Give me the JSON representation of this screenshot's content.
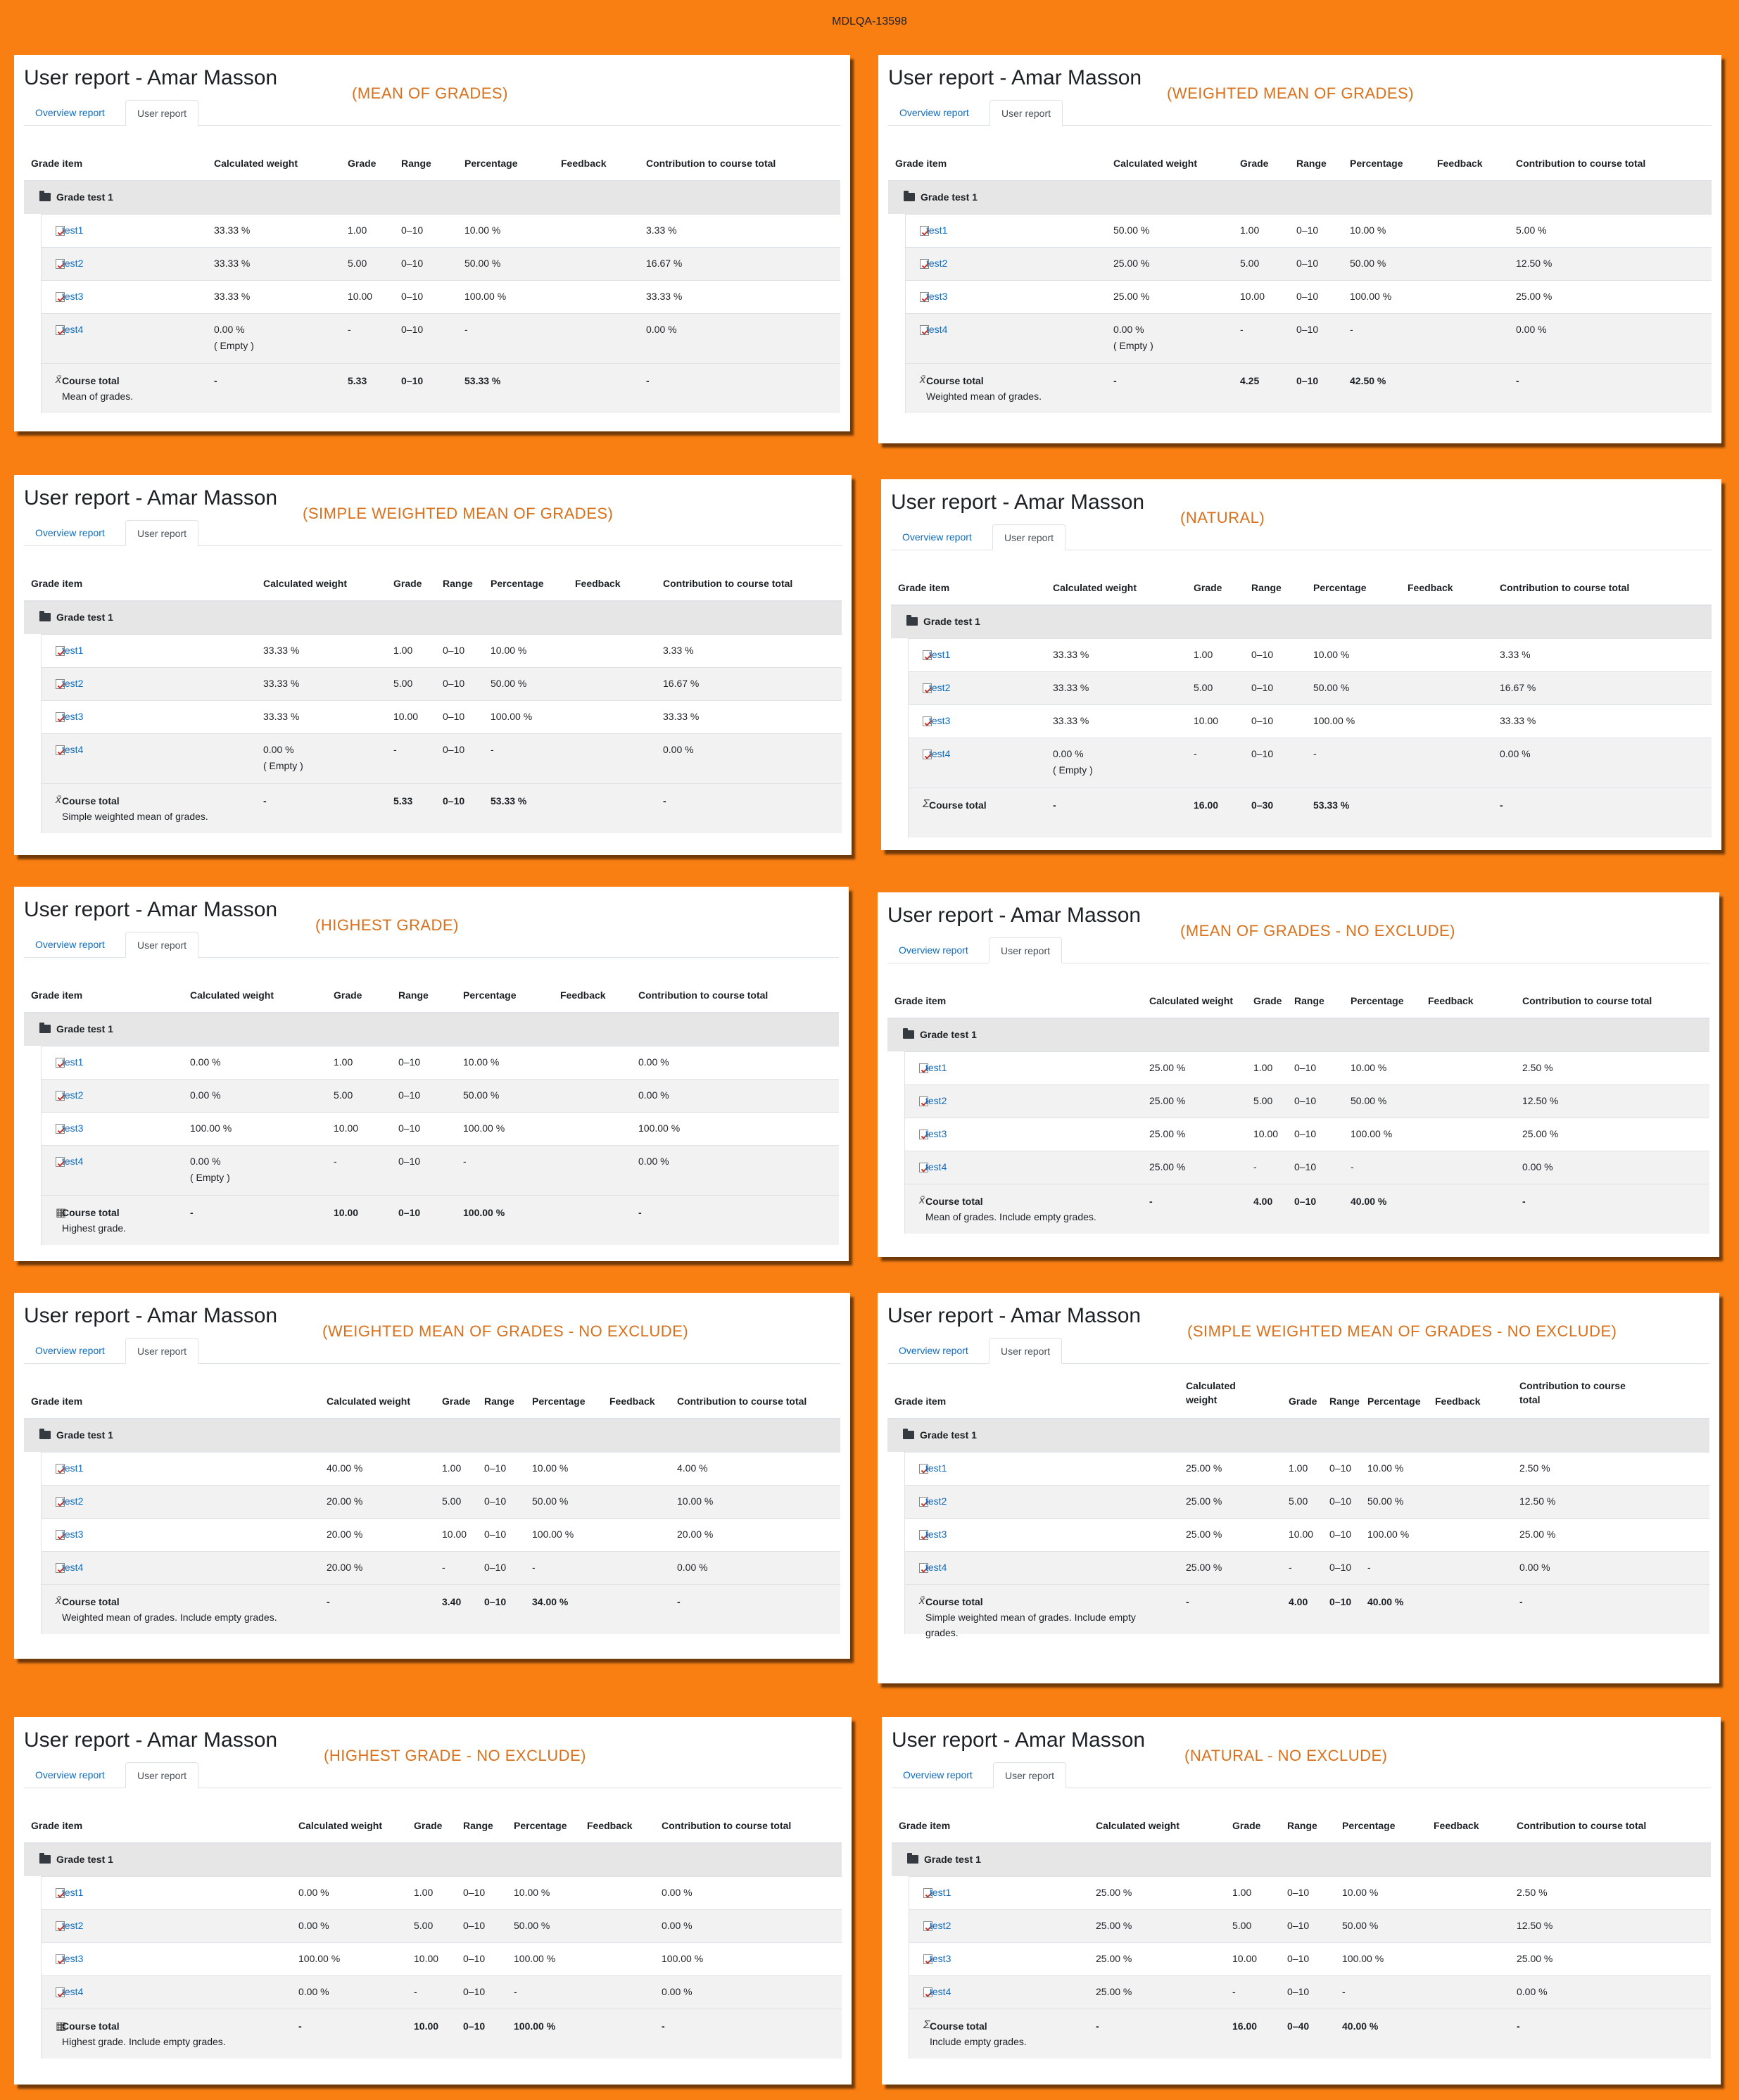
{
  "header": {
    "title": "MDLQA-13598"
  },
  "common": {
    "report_title": "User report - Amar Masson",
    "tab_overview": "Overview report",
    "tab_user": "User report",
    "col_grade_item": "Grade item",
    "col_calc_weight": "Calculated weight",
    "col_calc_weight_l1": "Calculated",
    "col_calc_weight_l2": "weight",
    "col_grade": "Grade",
    "col_range": "Range",
    "col_percentage": "Percentage",
    "col_feedback": "Feedback",
    "col_contribution": "Contribution to course total",
    "col_contribution_l1": "Contribution to course",
    "col_contribution_l2": "total",
    "category": "Grade test 1",
    "course_total": "Course total",
    "empty": "( Empty )"
  },
  "panels": [
    {
      "label": "(MEAN OF GRADES)",
      "total_desc": "Mean of grades.",
      "total_icon": "calc-icon",
      "rows": [
        [
          "test1",
          "33.33 %",
          "1.00",
          "0–10",
          "10.00 %",
          "3.33 %"
        ],
        [
          "test2",
          "33.33 %",
          "5.00",
          "0–10",
          "50.00 %",
          "16.67 %"
        ],
        [
          "test3",
          "33.33 %",
          "10.00",
          "0–10",
          "100.00 %",
          "33.33 %"
        ],
        [
          "test4",
          "0.00 %",
          "-",
          "0–10",
          "-",
          "0.00 %"
        ]
      ],
      "total": [
        "-",
        "5.33",
        "0–10",
        "53.33 %",
        "-"
      ],
      "test4_empty": true
    },
    {
      "label": "(WEIGHTED MEAN OF GRADES)",
      "total_desc": "Weighted mean of grades.",
      "total_icon": "calc-icon",
      "rows": [
        [
          "test1",
          "50.00 %",
          "1.00",
          "0–10",
          "10.00 %",
          "5.00 %"
        ],
        [
          "test2",
          "25.00 %",
          "5.00",
          "0–10",
          "50.00 %",
          "12.50 %"
        ],
        [
          "test3",
          "25.00 %",
          "10.00",
          "0–10",
          "100.00 %",
          "25.00 %"
        ],
        [
          "test4",
          "0.00 %",
          "-",
          "0–10",
          "-",
          "0.00 %"
        ]
      ],
      "total": [
        "-",
        "4.25",
        "0–10",
        "42.50 %",
        "-"
      ],
      "test4_empty": true
    },
    {
      "label": "(SIMPLE WEIGHTED MEAN OF GRADES)",
      "total_desc": "Simple weighted mean of grades.",
      "total_icon": "calc-icon",
      "rows": [
        [
          "test1",
          "33.33 %",
          "1.00",
          "0–10",
          "10.00 %",
          "3.33 %"
        ],
        [
          "test2",
          "33.33 %",
          "5.00",
          "0–10",
          "50.00 %",
          "16.67 %"
        ],
        [
          "test3",
          "33.33 %",
          "10.00",
          "0–10",
          "100.00 %",
          "33.33 %"
        ],
        [
          "test4",
          "0.00 %",
          "-",
          "0–10",
          "-",
          "0.00 %"
        ]
      ],
      "total": [
        "-",
        "5.33",
        "0–10",
        "53.33 %",
        "-"
      ],
      "test4_empty": true
    },
    {
      "label": "(NATURAL)",
      "total_desc": "",
      "total_icon": "sigma-icon",
      "rows": [
        [
          "test1",
          "33.33 %",
          "1.00",
          "0–10",
          "10.00 %",
          "3.33 %"
        ],
        [
          "test2",
          "33.33 %",
          "5.00",
          "0–10",
          "50.00 %",
          "16.67 %"
        ],
        [
          "test3",
          "33.33 %",
          "10.00",
          "0–10",
          "100.00 %",
          "33.33 %"
        ],
        [
          "test4",
          "0.00 %",
          "-",
          "0–10",
          "-",
          "0.00 %"
        ]
      ],
      "total": [
        "-",
        "16.00",
        "0–30",
        "53.33 %",
        "-"
      ],
      "test4_empty": true
    },
    {
      "label": "(HIGHEST GRADE)",
      "total_desc": "Highest grade.",
      "total_icon": "calculator-icon",
      "rows": [
        [
          "test1",
          "0.00 %",
          "1.00",
          "0–10",
          "10.00 %",
          "0.00 %"
        ],
        [
          "test2",
          "0.00 %",
          "5.00",
          "0–10",
          "50.00 %",
          "0.00 %"
        ],
        [
          "test3",
          "100.00 %",
          "10.00",
          "0–10",
          "100.00 %",
          "100.00 %"
        ],
        [
          "test4",
          "0.00 %",
          "-",
          "0–10",
          "-",
          "0.00 %"
        ]
      ],
      "total": [
        "-",
        "10.00",
        "0–10",
        "100.00 %",
        "-"
      ],
      "test4_empty": true
    },
    {
      "label": "(MEAN OF GRADES - NO EXCLUDE)",
      "total_desc": "Mean of grades. Include empty grades.",
      "total_icon": "calc-icon",
      "rows": [
        [
          "test1",
          "25.00 %",
          "1.00",
          "0–10",
          "10.00 %",
          "2.50 %"
        ],
        [
          "test2",
          "25.00 %",
          "5.00",
          "0–10",
          "50.00 %",
          "12.50 %"
        ],
        [
          "test3",
          "25.00 %",
          "10.00",
          "0–10",
          "100.00 %",
          "25.00 %"
        ],
        [
          "test4",
          "25.00 %",
          "-",
          "0–10",
          "-",
          "0.00 %"
        ]
      ],
      "total": [
        "-",
        "4.00",
        "0–10",
        "40.00 %",
        "-"
      ],
      "test4_empty": false
    },
    {
      "label": "(WEIGHTED MEAN OF GRADES - NO EXCLUDE)",
      "total_desc": "Weighted mean of grades. Include empty grades.",
      "total_icon": "calc-icon",
      "rows": [
        [
          "test1",
          "40.00 %",
          "1.00",
          "0–10",
          "10.00 %",
          "4.00 %"
        ],
        [
          "test2",
          "20.00 %",
          "5.00",
          "0–10",
          "50.00 %",
          "10.00 %"
        ],
        [
          "test3",
          "20.00 %",
          "10.00",
          "0–10",
          "100.00 %",
          "20.00 %"
        ],
        [
          "test4",
          "20.00 %",
          "-",
          "0–10",
          "-",
          "0.00 %"
        ]
      ],
      "total": [
        "-",
        "3.40",
        "0–10",
        "34.00 %",
        "-"
      ],
      "test4_empty": false
    },
    {
      "label": "(SIMPLE WEIGHTED MEAN OF GRADES - NO EXCLUDE)",
      "total_desc": "Simple weighted mean of grades. Include empty",
      "total_desc2": "grades.",
      "total_icon": "calc-icon",
      "rows": [
        [
          "test1",
          "25.00 %",
          "1.00",
          "0–10",
          "10.00 %",
          "2.50 %"
        ],
        [
          "test2",
          "25.00 %",
          "5.00",
          "0–10",
          "50.00 %",
          "12.50 %"
        ],
        [
          "test3",
          "25.00 %",
          "10.00",
          "0–10",
          "100.00 %",
          "25.00 %"
        ],
        [
          "test4",
          "25.00 %",
          "-",
          "0–10",
          "-",
          "0.00 %"
        ]
      ],
      "total": [
        "-",
        "4.00",
        "0–10",
        "40.00 %",
        "-"
      ],
      "test4_empty": false
    },
    {
      "label": "(HIGHEST GRADE - NO EXCLUDE)",
      "total_desc": "Highest grade. Include empty grades.",
      "total_icon": "calculator-icon",
      "rows": [
        [
          "test1",
          "0.00 %",
          "1.00",
          "0–10",
          "10.00 %",
          "0.00 %"
        ],
        [
          "test2",
          "0.00 %",
          "5.00",
          "0–10",
          "50.00 %",
          "0.00 %"
        ],
        [
          "test3",
          "100.00 %",
          "10.00",
          "0–10",
          "100.00 %",
          "100.00 %"
        ],
        [
          "test4",
          "0.00 %",
          "-",
          "0–10",
          "-",
          "0.00 %"
        ]
      ],
      "total": [
        "-",
        "10.00",
        "0–10",
        "100.00 %",
        "-"
      ],
      "test4_empty": false
    },
    {
      "label": "(NATURAL - NO EXCLUDE)",
      "total_desc": "Include empty grades.",
      "total_icon": "sigma-icon",
      "rows": [
        [
          "test1",
          "25.00 %",
          "1.00",
          "0–10",
          "10.00 %",
          "2.50 %"
        ],
        [
          "test2",
          "25.00 %",
          "5.00",
          "0–10",
          "50.00 %",
          "12.50 %"
        ],
        [
          "test3",
          "25.00 %",
          "10.00",
          "0–10",
          "100.00 %",
          "25.00 %"
        ],
        [
          "test4",
          "25.00 %",
          "-",
          "0–10",
          "-",
          "0.00 %"
        ]
      ],
      "total": [
        "-",
        "16.00",
        "0–40",
        "40.00 %",
        "-"
      ],
      "test4_empty": false
    }
  ]
}
